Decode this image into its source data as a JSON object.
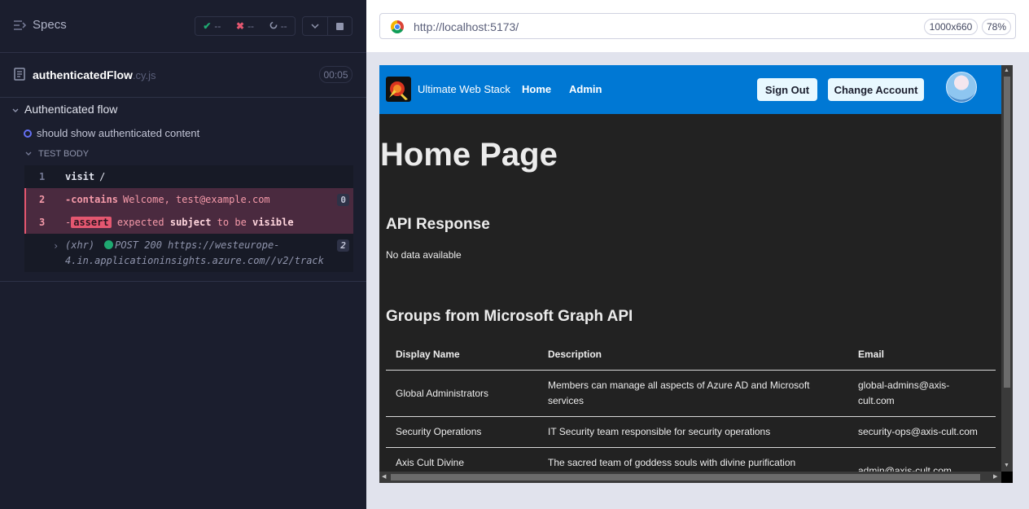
{
  "reporter": {
    "specs_label": "Specs",
    "stats": {
      "passed": "--",
      "failed": "--",
      "pending": "--"
    },
    "spec": {
      "name": "authenticatedFlow",
      "ext": ".cy.js",
      "duration": "00:05"
    },
    "suite_title": "Authenticated flow",
    "test_title": "should show authenticated content",
    "body_label": "TEST BODY",
    "commands": [
      {
        "num": "1",
        "name": "visit",
        "message": "/"
      },
      {
        "num": "2",
        "name": "-contains",
        "message": "Welcome, test@example.com",
        "badge": "0"
      },
      {
        "num": "3",
        "prefix": "-",
        "tag": "assert",
        "parts": [
          "expected",
          "subject",
          "to be",
          "visible"
        ]
      }
    ],
    "xhr": {
      "label": "(xhr)",
      "line1": "POST 200 https://westeurope-",
      "line2": "4.in.applicationinsights.azure.com//v2/track",
      "badge": "2"
    }
  },
  "browser": {
    "url": "http://localhost:5173/",
    "viewport": "1000x660",
    "scale": "78%"
  },
  "app": {
    "brand": "Ultimate Web Stack",
    "nav": {
      "home": "Home",
      "admin": "Admin"
    },
    "buttons": {
      "sign_out": "Sign Out",
      "change_account": "Change Account"
    },
    "page_title": "Home Page",
    "api_heading": "API Response",
    "api_text": "No data available",
    "groups_heading": "Groups from Microsoft Graph API",
    "table": {
      "headers": [
        "Display Name",
        "Description",
        "Email"
      ],
      "rows": [
        [
          "Global Administrators",
          "Members can manage all aspects of Azure AD and Microsoft services",
          "global-admins@axis-cult.com"
        ],
        [
          "Security Operations",
          "IT Security team responsible for security operations",
          "security-ops@axis-cult.com"
        ],
        [
          "Axis Cult Divine",
          "The sacred team of goddess souls with divine purification",
          "admin@axis-cult.com"
        ]
      ]
    }
  },
  "colors": {
    "reporter_bg": "#1b1e2e",
    "navbar": "#0078d4",
    "fail": "#e45770",
    "pass": "#1fa971"
  }
}
